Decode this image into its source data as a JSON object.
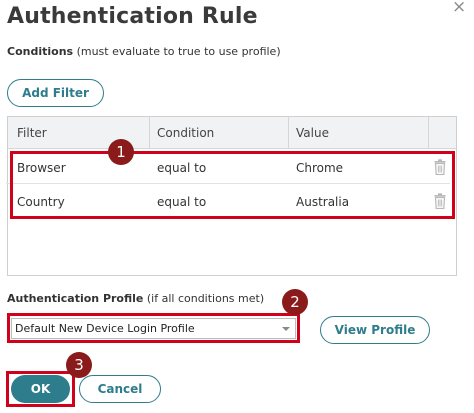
{
  "dialog": {
    "title": "Authentication Rule",
    "close_glyph": "×"
  },
  "conditions": {
    "label": "Conditions",
    "hint": " (must evaluate to true to use profile)"
  },
  "buttons": {
    "add_filter": "Add Filter",
    "view_profile": "View Profile",
    "ok": "OK",
    "cancel": "Cancel"
  },
  "table": {
    "columns": [
      "Filter",
      "Condition",
      "Value"
    ],
    "rows": [
      {
        "filter": "Browser",
        "condition": "equal to",
        "value": "Chrome",
        "action_icon": "trash-icon"
      },
      {
        "filter": "Country",
        "condition": "equal to",
        "value": "Australia",
        "action_icon": "trash-icon"
      }
    ]
  },
  "auth_profile": {
    "label": "Authentication Profile",
    "hint": " (if all conditions met)",
    "selected": "Default New Device Login Profile"
  },
  "annotations": {
    "step1": "1",
    "step2": "2",
    "step3": "3",
    "highlight_color": "#d0021b",
    "badge_color": "#8b1a1a"
  },
  "colors": {
    "accent": "#2e7d8c",
    "header_bg": "#f0f2f3"
  }
}
